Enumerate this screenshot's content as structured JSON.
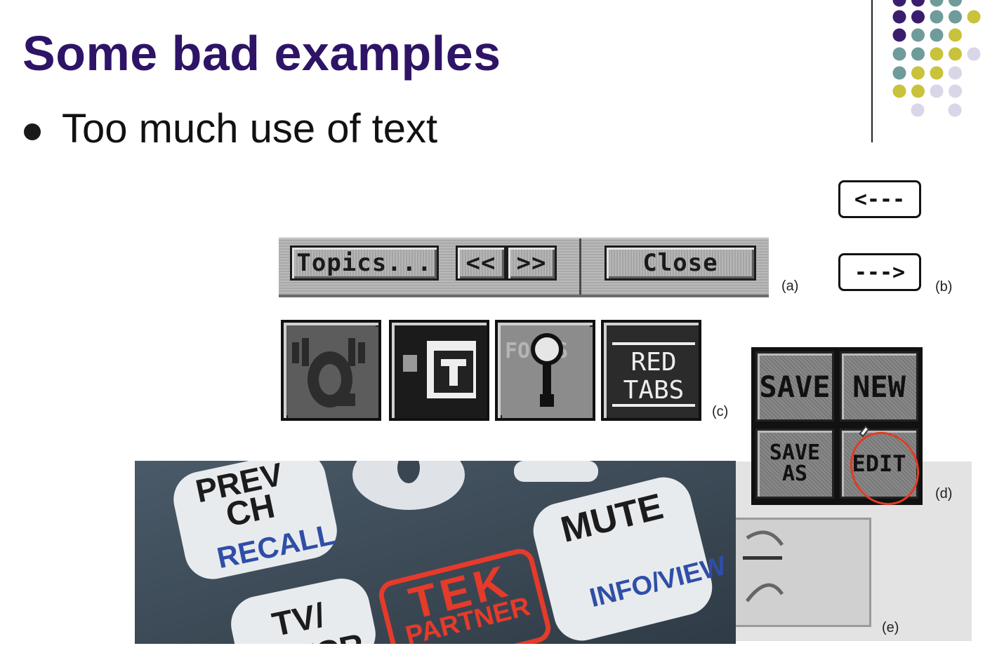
{
  "slide": {
    "title": "Some bad examples",
    "bullet": "Too much use of text"
  },
  "colors": {
    "title": "#2e1466",
    "dot_purple": "#3b1d6e",
    "dot_teal": "#6e9c9b",
    "dot_yellow": "#c8c33a",
    "dot_lavender": "#d9d6e8",
    "remote_red": "#e63a2a"
  },
  "figure_a": {
    "buttons": [
      "Topics...",
      "<<",
      ">>",
      "Close"
    ],
    "caption": "(a)"
  },
  "figure_b": {
    "buttons": [
      "<---",
      "--->"
    ],
    "caption": "(b)"
  },
  "figure_c": {
    "icons": [
      "q-speaker-icon",
      "folder-t-icon",
      "focus-magnifier-icon",
      "red-tabs-icon"
    ],
    "focus_label": "FOCUS",
    "red_tabs_label": [
      "RED",
      "TABS"
    ],
    "caption": "(c)"
  },
  "figure_d": {
    "buttons": [
      "SAVE",
      "NEW",
      "SAVE AS",
      "EDIT"
    ],
    "caption": "(d)"
  },
  "figure_e": {
    "caption": "(e)"
  },
  "remote": {
    "buttons": [
      {
        "line1": "PREV",
        "line2": "CH",
        "line3": "RECALL"
      },
      {
        "line1": "MUTE",
        "line2": "INFO/VIEW"
      },
      {
        "line1": "TV/",
        "line2": "VCR"
      }
    ],
    "logo": [
      "TEK",
      "PARTNER"
    ]
  }
}
